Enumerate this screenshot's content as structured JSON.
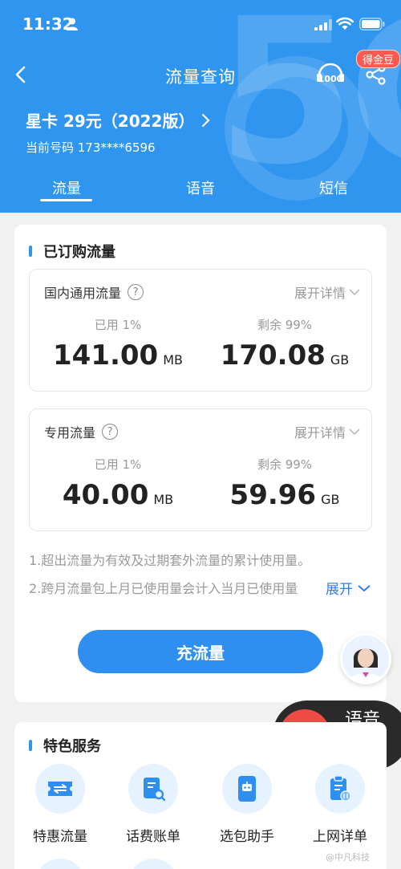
{
  "status_bar": {
    "time": "11:32"
  },
  "nav": {
    "title": "流量查询",
    "coin_badge": "得金豆"
  },
  "plan": {
    "name": "星卡 29元（2022版）",
    "phone": "当前号码 173****6596"
  },
  "tabs": [
    "流量",
    "语音",
    "短信"
  ],
  "subscribed": {
    "title": "已订购流量",
    "domestic": {
      "label": "国内通用流量",
      "expand": "展开详情",
      "used_label": "已用 1%",
      "used_value": "141.00",
      "used_unit": "MB",
      "remaining_label": "剩余 99%",
      "remaining_value": "170.08",
      "remaining_unit": "GB"
    },
    "dedicated": {
      "label": "专用流量",
      "expand": "展开详情",
      "used_label": "已用 1%",
      "used_value": "40.00",
      "used_unit": "MB",
      "remaining_label": "剩余 99%",
      "remaining_value": "59.96",
      "remaining_unit": "GB"
    },
    "notes": [
      "1.超出流量为有效及过期套外流量的累计使用量。",
      "2.跨月流量包上月已使用量会计入当月已使用量"
    ],
    "notes_expand": "展开",
    "recharge_button": "充流量"
  },
  "voice_broadcast": {
    "label": "语音播报"
  },
  "services": {
    "title": "特色服务",
    "items": [
      "特惠流量",
      "话费账单",
      "选包助手",
      "上网详单"
    ]
  },
  "watermark": "@中凡科技",
  "colors": {
    "primary": "#2f95ef",
    "button": "#2f8ff0",
    "badge": "#ff5a4f",
    "voice_red": "#ef4b45"
  }
}
